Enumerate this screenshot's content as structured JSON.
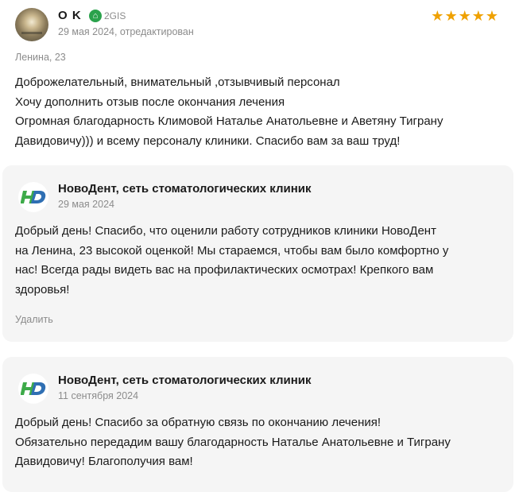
{
  "review": {
    "author": "O K",
    "source": {
      "icon": "2gis-logo-icon",
      "label": "2GIS"
    },
    "date": "29 мая 2024, отредактирован",
    "rating": 5,
    "address": "Ленина, 23",
    "lines": [
      "Доброжелательный, внимательный ,отзывчивый персонал",
      "Хочу дополнить отзыв после окончания лечения",
      "Огромная благодарность Климовой Наталье Анатольевне и Аветяну Тиграну",
      "Давидовичу))) и всему персоналу клиники. Спасибо вам за ваш труд!"
    ]
  },
  "replies": [
    {
      "author": "НовоДент, сеть стоматологических клиник",
      "date": "29 мая 2024",
      "lines": [
        "Добрый день! Спасибо, что оценили работу сотрудников клиники НовоДент",
        "на Ленина, 23 высокой оценкой! Мы стараемся, чтобы вам было комфортно у",
        "нас! Всегда рады видеть вас на профилактических осмотрах! Крепкого вам",
        "здоровья!"
      ],
      "delete_label": "Удалить"
    },
    {
      "author": "НовоДент, сеть стоматологических клиник",
      "date": "11 сентября 2024",
      "lines": [
        "Добрый день! Спасибо за обратную связь по окончанию лечения!",
        "Обязательно передадим вашу благодарность Наталье Анатольевне и Тиграну",
        "Давидовичу! Благополучия вам!"
      ]
    }
  ],
  "colors": {
    "star": "#efa100",
    "source": "#2ba24c",
    "logo_green": "#3daa49",
    "logo_blue": "#2f6fb3",
    "reply_bg": "#f5f5f5",
    "muted": "#8c8c8c"
  }
}
